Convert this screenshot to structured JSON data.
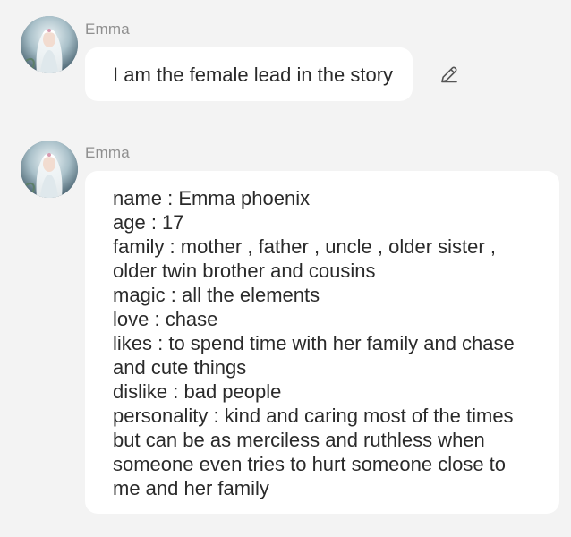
{
  "messages": [
    {
      "sender": "Emma",
      "text": "I am the female lead in the story"
    },
    {
      "sender": "Emma",
      "lines": [
        "name : Emma phoenix",
        "age : 17",
        "family : mother , father , uncle , older sister ,",
        "older twin brother and cousins",
        "magic : all the elements",
        "love : chase",
        "likes : to spend time with her family and chase",
        "and cute things",
        "dislike : bad people",
        "personality : kind and caring most of the times",
        "but can be as merciless and ruthless when",
        "someone even tries to hurt someone close to",
        "me and her family"
      ]
    }
  ],
  "icons": {
    "edit": "pencil-edit-icon",
    "avatar": "character-avatar-image"
  },
  "colors": {
    "background": "#f3f3f3",
    "bubble": "#ffffff",
    "sender_name": "#8f8f8f",
    "text": "#2a2a2a"
  }
}
